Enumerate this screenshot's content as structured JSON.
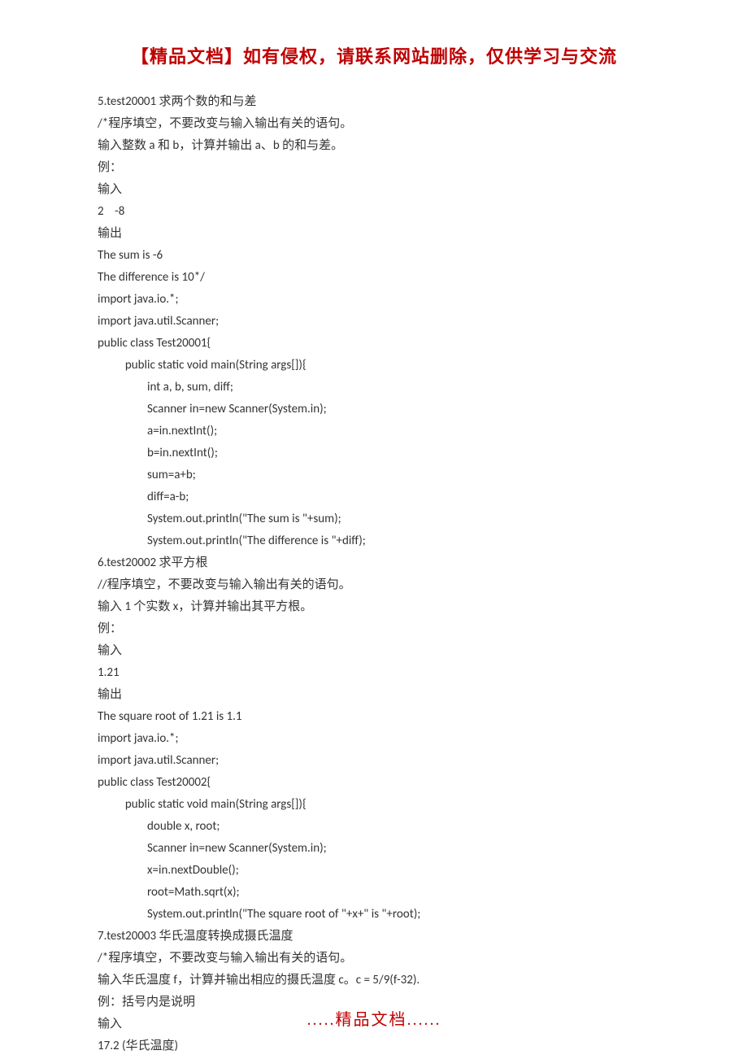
{
  "header": "【精品文档】如有侵权，请联系网站删除，仅供学习与交流",
  "footer": ".....精品文档......",
  "lines": [
    "5.test20001 求两个数的和与差",
    "/*程序填空，不要改变与输入输出有关的语句。",
    "输入整数 a 和 b，计算并输出 a、b 的和与差。",
    "例：",
    "输入",
    "2    -8",
    "输出",
    "The sum is -6",
    "The difference is 10*/",
    "import java.io.*;",
    "import java.util.Scanner;",
    "public class Test20001{",
    "          public static void main(String args[]){",
    "                  int a, b, sum, diff;",
    "                  Scanner in=new Scanner(System.in);",
    "                  a=in.nextInt();",
    "                  b=in.nextInt();",
    "                  sum=a+b;",
    "                  diff=a-b;",
    "                  System.out.println(\"The sum is \"+sum);",
    "                  System.out.println(\"The difference is \"+diff);",
    "6.test20002 求平方根",
    "//程序填空，不要改变与输入输出有关的语句。",
    "输入 1 个实数 x，计算并输出其平方根。",
    "例：",
    "输入",
    "1.21",
    "输出",
    "The square root of 1.21 is 1.1",
    "import java.io.*;",
    "import java.util.Scanner;",
    "public class Test20002{",
    "          public static void main(String args[]){",
    "                  double x, root;",
    "                  Scanner in=new Scanner(System.in);",
    "                  x=in.nextDouble();",
    "                  root=Math.sqrt(x);",
    "                  System.out.println(\"The square root of \"+x+\" is \"+root);",
    "7.test20003 华氏温度转换成摄氏温度",
    "/*程序填空，不要改变与输入输出有关的语句。",
    "输入华氏温度 f，计算并输出相应的摄氏温度 c。c = 5/9(f-32).",
    "例：括号内是说明",
    "输入",
    "17.2 (华氏温度)"
  ]
}
